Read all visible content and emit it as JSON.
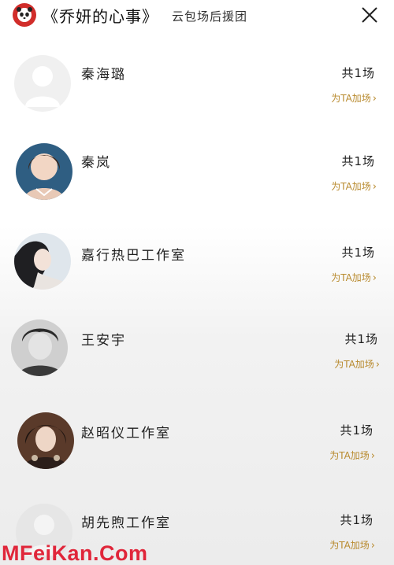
{
  "header": {
    "title": "《乔妍的心事》",
    "subtitle": "云包场后援团",
    "logo_icon": "panda-logo-icon",
    "close_icon": "close-icon"
  },
  "supporters": [
    {
      "name": "秦海璐",
      "count": "共1场",
      "action": "为TA加场",
      "avatar": "placeholder"
    },
    {
      "name": "秦岚",
      "count": "共1场",
      "action": "为TA加场",
      "avatar": "photo"
    },
    {
      "name": "嘉行热巴工作室",
      "count": "共1场",
      "action": "为TA加场",
      "avatar": "photo"
    },
    {
      "name": "王安宇",
      "count": "共1场",
      "action": "为TA加场",
      "avatar": "photo"
    },
    {
      "name": "赵昭仪工作室",
      "count": "共1场",
      "action": "为TA加场",
      "avatar": "photo"
    },
    {
      "name": "胡先煦工作室",
      "count": "共1场",
      "action": "为TA加场",
      "avatar": "placeholder"
    }
  ],
  "watermark": "MFeiKan.Com",
  "colors": {
    "accent_gold": "#b88a2e",
    "logo_red": "#d12d2a",
    "watermark_red": "#e0263a"
  }
}
